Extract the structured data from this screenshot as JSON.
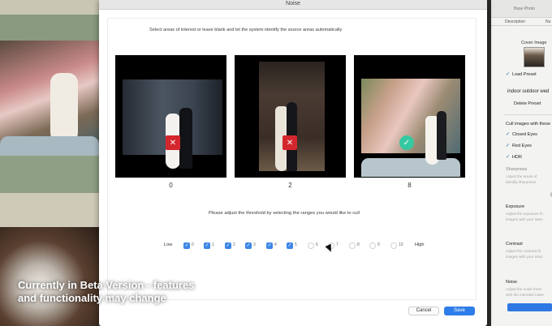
{
  "dialog": {
    "title": "Noise",
    "instruction": "Select areas of interest or leave blank and let the system identify the source areas automatically",
    "threshold_instruction": "Please adjust the threshold by selecting the ranges you would like to cull",
    "cancel_label": "Cancel",
    "save_label": "Save"
  },
  "image_groups": [
    {
      "count": "0",
      "status": "rejected",
      "status_icon": "x-icon"
    },
    {
      "count": "2",
      "status": "rejected",
      "status_icon": "x-icon"
    },
    {
      "count": "8",
      "status": "accepted",
      "status_icon": "check-icon"
    }
  ],
  "range": {
    "low_label": "Low",
    "high_label": "High",
    "items": [
      {
        "label": "0",
        "checked": true
      },
      {
        "label": "1",
        "checked": true
      },
      {
        "label": "2",
        "checked": true
      },
      {
        "label": "3",
        "checked": true
      },
      {
        "label": "4",
        "checked": true
      },
      {
        "label": "5",
        "checked": true
      },
      {
        "label": "6",
        "checked": false
      },
      {
        "label": "7",
        "checked": false
      },
      {
        "label": "8",
        "checked": false
      },
      {
        "label": "9",
        "checked": false
      },
      {
        "label": "10",
        "checked": false
      }
    ]
  },
  "right_panel": {
    "header_title": "Base Photo",
    "tab_description": "Description",
    "tab_other": "Nu",
    "cover_image_label": "Cover Image",
    "load_preset": "Load Preset",
    "preset_name": "indoor outdoor wed",
    "delete_preset": "Delete Preset",
    "cull_heading": "Cull images with these",
    "cull_options": [
      "Closed Eyes",
      "Red Eyes",
      "HDR"
    ],
    "sharpness_title": "Sharpness",
    "sharpness_desc_1": "Adjust the areas of",
    "sharpness_desc_2": "identify sharpness",
    "exposure_title": "Exposure",
    "exposure_desc_1": "Adjust the exposure th",
    "exposure_desc_2": "images with your inten",
    "contrast_title": "Contrast",
    "contrast_desc_1": "Adjust the contrast th",
    "contrast_desc_2": "images with your inten",
    "noise_title": "Noise",
    "noise_desc_1": "Adjust the noise thres",
    "noise_desc_2": "with the intended noise",
    "side_marker": "C"
  },
  "overlay": {
    "line1": "Currently in Beta Version - features",
    "line2": "and functionality may change"
  },
  "colors": {
    "accent_blue": "#2f7de8",
    "reject_red": "#d4262d",
    "accept_green": "#35c9a2"
  }
}
